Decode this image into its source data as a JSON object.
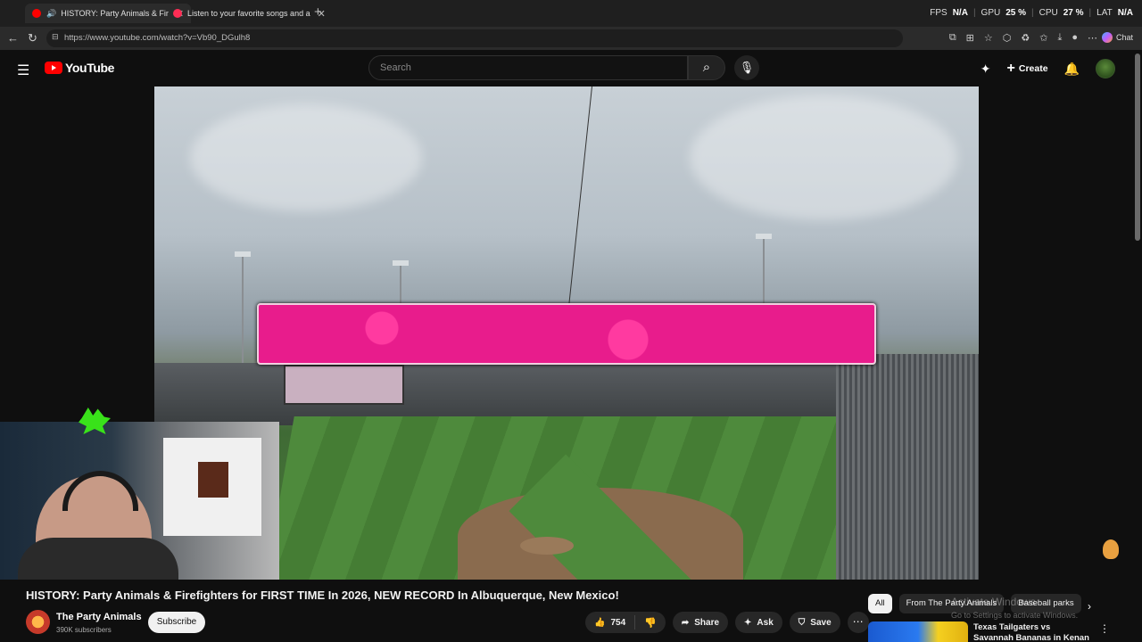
{
  "browser": {
    "tabs": [
      {
        "title": "HISTORY: Party Animals & Fir",
        "active": true,
        "favicon_color": "#ff0000"
      },
      {
        "title": "Listen to your favorite songs and a",
        "active": false,
        "favicon_color": "#ff2d55"
      }
    ],
    "perf": {
      "fps_label": "FPS",
      "fps_value": "N/A",
      "gpu_label": "GPU",
      "gpu_value": "25 %",
      "cpu_label": "CPU",
      "cpu_value": "27 %",
      "lat_label": "LAT",
      "lat_value": "N/A"
    },
    "url": "https://www.youtube.com/watch?v=Vb90_DGulh8",
    "chat_label": "Chat"
  },
  "youtube": {
    "logo_text": "YouTube",
    "search_placeholder": "Search",
    "create_label": "Create"
  },
  "video": {
    "title": "HISTORY: Party Animals & Firefighters for FIRST TIME In 2026, NEW RECORD In Albuquerque, New Mexico!",
    "banner_color": "#e81c8c"
  },
  "channel": {
    "name": "The Party Animals",
    "subscribers": "390K subscribers",
    "subscribe_label": "Subscribe"
  },
  "actions": {
    "likes": "754",
    "share_label": "Share",
    "ask_label": "Ask",
    "save_label": "Save"
  },
  "sidebar": {
    "chips": [
      "All",
      "From The Party Animals",
      "Baseball parks"
    ],
    "watermark_line1": "Activate Windows",
    "watermark_line2": "Go to Settings to activate Windows.",
    "recommendation_title": "Texas Tailgaters vs Savannah Bananas in Kenan Stadium at ..."
  },
  "colors": {
    "background": "#0f0f0f",
    "accent_red": "#ff0000",
    "webcam_mascot": "#39e21a"
  }
}
